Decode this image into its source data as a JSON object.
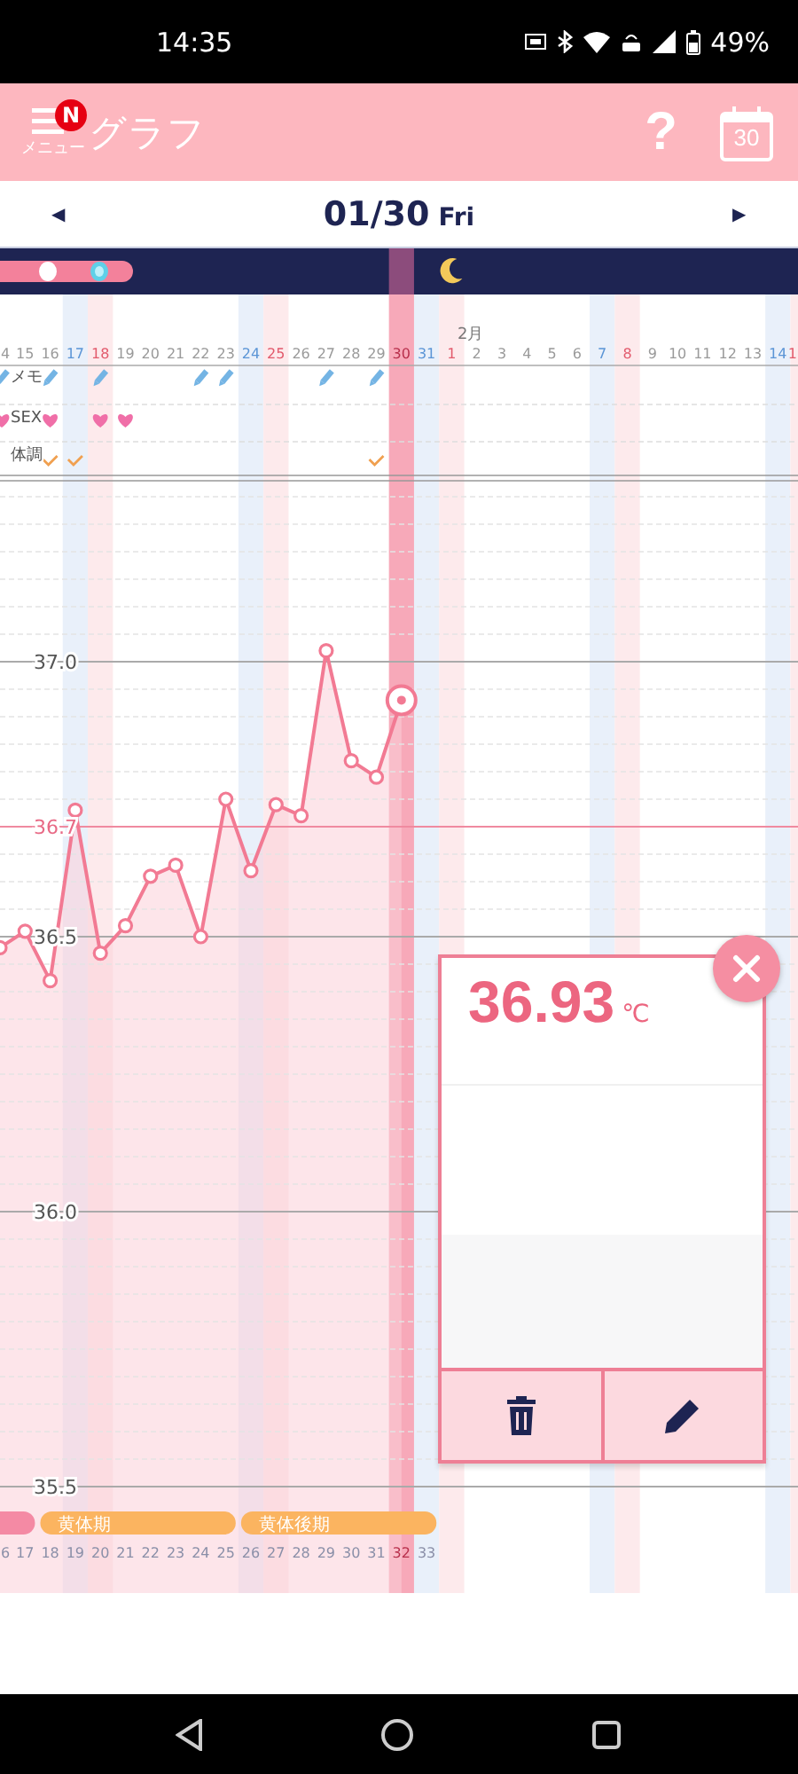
{
  "status_bar": {
    "time": "14:35",
    "battery": "49%"
  },
  "app_bar": {
    "menu_label": "メニュー",
    "badge": "N",
    "title": "グラフ",
    "help": "?",
    "calendar_day": "30"
  },
  "date_nav": {
    "prev": "◀",
    "date": "01/30",
    "weekday": "Fri",
    "next": "▶"
  },
  "month_label": "2月",
  "marker_rows": [
    {
      "label": "メモ",
      "kind": "memo"
    },
    {
      "label": "SEX",
      "kind": "sex"
    },
    {
      "label": "体調",
      "kind": "condition"
    }
  ],
  "days": [
    {
      "label": "4",
      "kind": "weekday",
      "selected": false,
      "memo": true,
      "sex": true,
      "condition": false,
      "moon": false
    },
    {
      "label": "15",
      "kind": "weekday",
      "selected": false,
      "memo": false,
      "sex": false,
      "condition": false,
      "moon": false
    },
    {
      "label": "16",
      "kind": "weekday",
      "selected": false,
      "memo": true,
      "sex": true,
      "condition": true,
      "moon": false
    },
    {
      "label": "17",
      "kind": "saturday",
      "selected": false,
      "memo": false,
      "sex": false,
      "condition": true,
      "moon": false
    },
    {
      "label": "18",
      "kind": "sunday",
      "selected": false,
      "memo": true,
      "sex": true,
      "condition": false,
      "moon": false
    },
    {
      "label": "19",
      "kind": "weekday",
      "selected": false,
      "memo": false,
      "sex": true,
      "condition": false,
      "moon": false
    },
    {
      "label": "20",
      "kind": "weekday",
      "selected": false,
      "memo": false,
      "sex": false,
      "condition": false,
      "moon": false
    },
    {
      "label": "21",
      "kind": "weekday",
      "selected": false,
      "memo": false,
      "sex": false,
      "condition": false,
      "moon": false
    },
    {
      "label": "22",
      "kind": "weekday",
      "selected": false,
      "memo": true,
      "sex": false,
      "condition": false,
      "moon": false
    },
    {
      "label": "23",
      "kind": "weekday",
      "selected": false,
      "memo": true,
      "sex": false,
      "condition": false,
      "moon": false
    },
    {
      "label": "24",
      "kind": "saturday",
      "selected": false,
      "memo": false,
      "sex": false,
      "condition": false,
      "moon": false
    },
    {
      "label": "25",
      "kind": "sunday",
      "selected": false,
      "memo": false,
      "sex": false,
      "condition": false,
      "moon": false
    },
    {
      "label": "26",
      "kind": "weekday",
      "selected": false,
      "memo": false,
      "sex": false,
      "condition": false,
      "moon": false
    },
    {
      "label": "27",
      "kind": "weekday",
      "selected": false,
      "memo": true,
      "sex": false,
      "condition": false,
      "moon": false
    },
    {
      "label": "28",
      "kind": "weekday",
      "selected": false,
      "memo": false,
      "sex": false,
      "condition": false,
      "moon": false
    },
    {
      "label": "29",
      "kind": "weekday",
      "selected": false,
      "memo": true,
      "sex": false,
      "condition": true,
      "moon": false
    },
    {
      "label": "30",
      "kind": "weekday",
      "selected": true,
      "memo": false,
      "sex": false,
      "condition": false,
      "moon": false
    },
    {
      "label": "31",
      "kind": "saturday",
      "selected": false,
      "memo": false,
      "sex": false,
      "condition": false,
      "moon": false
    },
    {
      "label": "1",
      "kind": "sunday",
      "selected": false,
      "memo": false,
      "sex": false,
      "condition": false,
      "moon": true
    },
    {
      "label": "2",
      "kind": "weekday",
      "selected": false,
      "memo": false,
      "sex": false,
      "condition": false,
      "moon": false
    },
    {
      "label": "3",
      "kind": "weekday",
      "selected": false,
      "memo": false,
      "sex": false,
      "condition": false,
      "moon": false
    },
    {
      "label": "4",
      "kind": "weekday",
      "selected": false,
      "memo": false,
      "sex": false,
      "condition": false,
      "moon": false
    },
    {
      "label": "5",
      "kind": "weekday",
      "selected": false,
      "memo": false,
      "sex": false,
      "condition": false,
      "moon": false
    },
    {
      "label": "6",
      "kind": "weekday",
      "selected": false,
      "memo": false,
      "sex": false,
      "condition": false,
      "moon": false
    },
    {
      "label": "7",
      "kind": "saturday",
      "selected": false,
      "memo": false,
      "sex": false,
      "condition": false,
      "moon": false
    },
    {
      "label": "8",
      "kind": "sunday",
      "selected": false,
      "memo": false,
      "sex": false,
      "condition": false,
      "moon": false
    },
    {
      "label": "9",
      "kind": "weekday",
      "selected": false,
      "memo": false,
      "sex": false,
      "condition": false,
      "moon": false
    },
    {
      "label": "10",
      "kind": "weekday",
      "selected": false,
      "memo": false,
      "sex": false,
      "condition": false,
      "moon": false
    },
    {
      "label": "11",
      "kind": "weekday",
      "selected": false,
      "memo": false,
      "sex": false,
      "condition": false,
      "moon": false
    },
    {
      "label": "12",
      "kind": "weekday",
      "selected": false,
      "memo": false,
      "sex": false,
      "condition": false,
      "moon": false
    },
    {
      "label": "13",
      "kind": "weekday",
      "selected": false,
      "memo": false,
      "sex": false,
      "condition": false,
      "moon": false
    },
    {
      "label": "14",
      "kind": "saturday",
      "selected": false,
      "memo": false,
      "sex": false,
      "condition": false,
      "moon": false
    },
    {
      "label": "1",
      "kind": "sunday",
      "selected": false,
      "memo": false,
      "sex": false,
      "condition": false,
      "moon": false
    }
  ],
  "chart": {
    "chart_data": {
      "type": "area",
      "grid": true,
      "categories": [
        "6",
        "17",
        "18",
        "19",
        "20",
        "21",
        "22",
        "23",
        "24",
        "25",
        "26",
        "27",
        "28",
        "29",
        "30",
        "31",
        "32",
        "33"
      ],
      "series": [
        {
          "color": "#f27a93",
          "marker": "circle",
          "values": [
            36.48,
            36.51,
            36.42,
            36.73,
            36.47,
            36.52,
            36.61,
            36.63,
            36.5,
            36.75,
            36.62,
            36.74,
            36.72,
            37.02,
            36.82,
            36.79,
            36.93,
            null
          ]
        }
      ],
      "ylim": [
        35.5,
        37.3
      ],
      "yticks": [
        {
          "value": 37.0,
          "label": "37.0"
        },
        {
          "value": 36.7,
          "label": "36.7"
        },
        {
          "value": 36.5,
          "label": "36.5"
        },
        {
          "value": 36.0,
          "label": "36.0"
        },
        {
          "value": 35.5,
          "label": "35.5"
        }
      ],
      "ref_lines": [
        {
          "axis": "y",
          "value": 36.7
        }
      ]
    }
  },
  "phases": [
    {
      "kind": "low"
    },
    {
      "kind": "luteal",
      "label": "黄体期"
    },
    {
      "kind": "late_luteal",
      "label": "黄体後期"
    }
  ],
  "cycle_days": [
    {
      "kind": "low"
    },
    {
      "kind": "low"
    },
    {
      "kind": "luteal"
    },
    {
      "kind": "luteal"
    },
    {
      "kind": "luteal"
    },
    {
      "kind": "luteal"
    },
    {
      "kind": "luteal"
    },
    {
      "kind": "luteal"
    },
    {
      "kind": "luteal"
    },
    {
      "kind": "luteal"
    },
    {
      "kind": "late_luteal"
    },
    {
      "kind": "late_luteal"
    },
    {
      "kind": "late_luteal"
    },
    {
      "kind": "late_luteal"
    },
    {
      "kind": "late_luteal"
    },
    {
      "kind": "late_luteal"
    },
    {
      "kind": "late_luteal"
    },
    {
      "kind": "late_luteal"
    }
  ],
  "popup": {
    "value": "36.93",
    "unit": "℃"
  }
}
